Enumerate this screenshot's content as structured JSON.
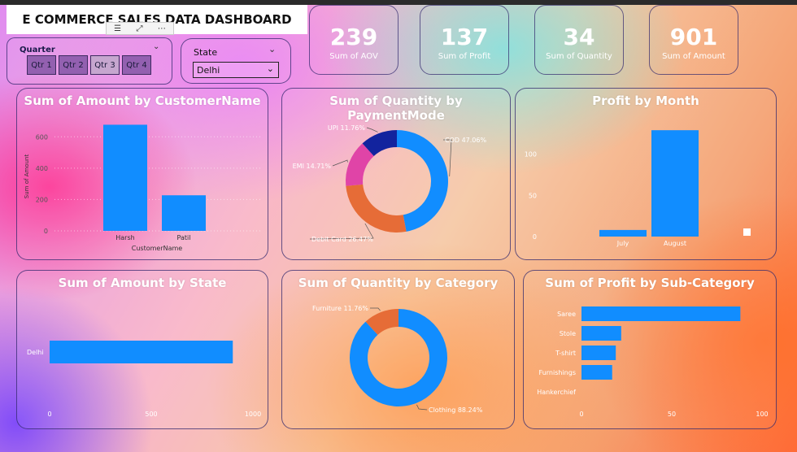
{
  "dashboard_title": "E COMMERCE SALES DATA DASHBOARD",
  "toolbar": {
    "filter_icon": "filter-icon",
    "focus_icon": "focus-mode-icon",
    "more_icon": "more-options-icon"
  },
  "quarter_slicer": {
    "label": "Quarter",
    "buttons": [
      "Qtr 1",
      "Qtr 2",
      "Qtr 3",
      "Qtr 4"
    ],
    "selected": "Qtr 3"
  },
  "state_slicer": {
    "label": "State",
    "value": "Delhi"
  },
  "kpis": [
    {
      "value": "239",
      "label": "Sum of AOV"
    },
    {
      "value": "137",
      "label": "Sum of Profit"
    },
    {
      "value": "34",
      "label": "Sum of Quantity"
    },
    {
      "value": "901",
      "label": "Sum of Amount"
    }
  ],
  "chart_data": [
    {
      "type": "bar",
      "title": "Sum of Amount by CustomerName",
      "xlabel": "CustomerName",
      "ylabel": "Sum of Amount",
      "categories": [
        "Harsh",
        "Patil"
      ],
      "values": [
        677,
        227
      ],
      "ylim": [
        0,
        700
      ],
      "yticks": [
        0,
        200,
        400,
        600
      ]
    },
    {
      "type": "pie",
      "title": "Sum of Quantity by PaymentMode",
      "labels": [
        "COD",
        "Debit Card",
        "EMI",
        "UPI"
      ],
      "values": [
        47.06,
        26.47,
        14.71,
        11.76
      ],
      "display": [
        "COD 47.06%",
        "Debit Card 26.47%",
        "EMI 14.71%",
        "UPI 11.76%"
      ],
      "colors": [
        "#118DFF",
        "#E66C37",
        "#E044A7",
        "#12239E"
      ]
    },
    {
      "type": "bar",
      "title": "Profit by Month",
      "categories": [
        "July",
        "August"
      ],
      "values": [
        8,
        129
      ],
      "ylim": [
        0,
        140
      ],
      "yticks": [
        0,
        50,
        100
      ]
    },
    {
      "type": "bar",
      "orientation": "horizontal",
      "title": "Sum of Amount by State",
      "categories": [
        "Delhi"
      ],
      "values": [
        901
      ],
      "xlim": [
        0,
        1000
      ],
      "xticks": [
        0,
        500,
        1000
      ]
    },
    {
      "type": "pie",
      "title": "Sum of Quantity by Category",
      "labels": [
        "Clothing",
        "Furniture"
      ],
      "values": [
        88.24,
        11.76
      ],
      "display": [
        "Clothing 88.24%",
        "Furniture 11.76%"
      ],
      "colors": [
        "#118DFF",
        "#E66C37"
      ]
    },
    {
      "type": "bar",
      "orientation": "horizontal",
      "title": "Sum of Profit by Sub-Category",
      "categories": [
        "Saree",
        "Stole",
        "T-shirt",
        "Furnishings",
        "Hankerchief"
      ],
      "values": [
        88,
        22,
        19,
        17,
        0
      ],
      "xlim": [
        0,
        100
      ],
      "xticks": [
        0,
        50,
        100
      ]
    }
  ],
  "colors": {
    "bar": "#118DFF",
    "card_border": "#32286E",
    "text": "#FFFFFF"
  }
}
